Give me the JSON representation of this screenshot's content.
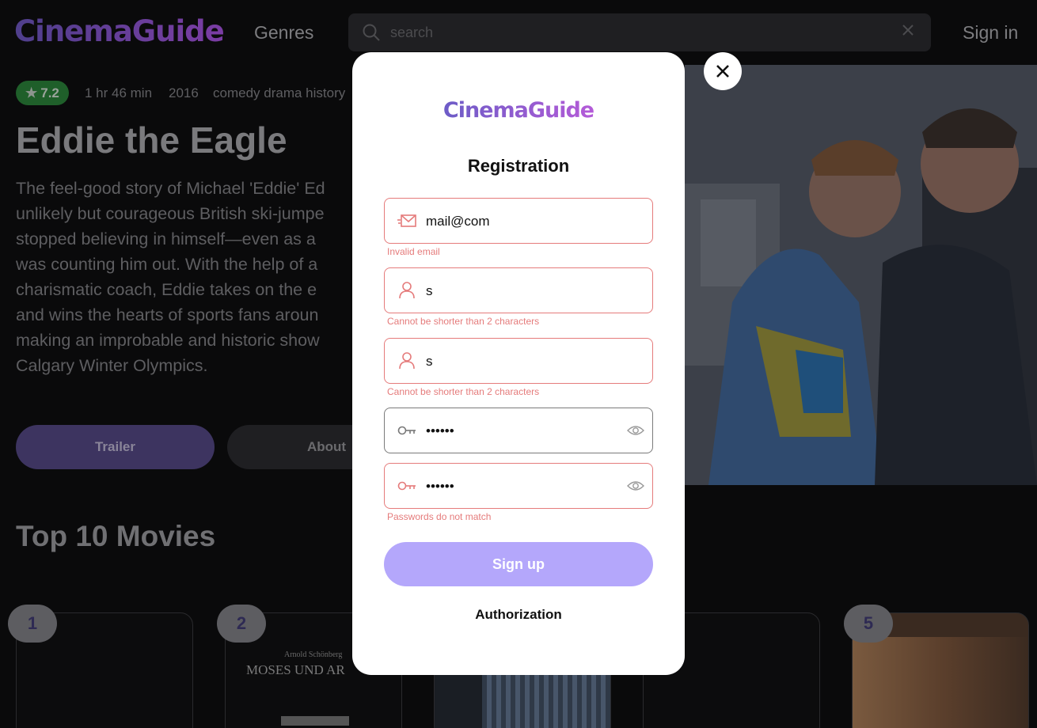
{
  "header": {
    "logo": "CinemaGuide",
    "genres": "Genres",
    "search_placeholder": "search",
    "sign_in": "Sign in"
  },
  "hero": {
    "rating": "7.2",
    "duration": "1 hr 46 min",
    "year": "2016",
    "genres": "comedy drama history",
    "title": "Eddie the Eagle",
    "description_lines": [
      "The feel-good story of Michael 'Eddie' Ed",
      "unlikely but courageous British ski-jumpe",
      "stopped believing in himself—even as a",
      "was counting him out. With the help of a",
      "charismatic coach, Eddie takes on the e",
      "and wins the hearts of sports fans aroun",
      "making an improbable and historic show",
      "Calgary Winter Olympics."
    ],
    "trailer": "Trailer",
    "about": "About"
  },
  "top_movies": {
    "heading": "Top 10 Movies",
    "ranks": [
      "1",
      "2",
      "5"
    ],
    "card2_author": "Arnold Schönberg",
    "card2_title": "MOSES UND AR"
  },
  "modal": {
    "logo": "CinemaGuide",
    "heading": "Registration",
    "fields": [
      {
        "icon": "mail-icon",
        "value": "mail@com",
        "error": "Invalid email"
      },
      {
        "icon": "user-icon",
        "value": "s",
        "error": "Cannot be shorter than 2 characters"
      },
      {
        "icon": "user-icon",
        "value": "s",
        "error": "Cannot be shorter than 2 characters"
      },
      {
        "icon": "key-icon",
        "value": "••••••",
        "error": ""
      },
      {
        "icon": "key-icon",
        "value": "••••••",
        "error": "Passwords do not match"
      }
    ],
    "signup": "Sign up",
    "authorization": "Authorization"
  },
  "colors": {
    "accent": "#b4a7fb",
    "error": "#e57b7b",
    "rating_badge": "#1f5f2a"
  }
}
